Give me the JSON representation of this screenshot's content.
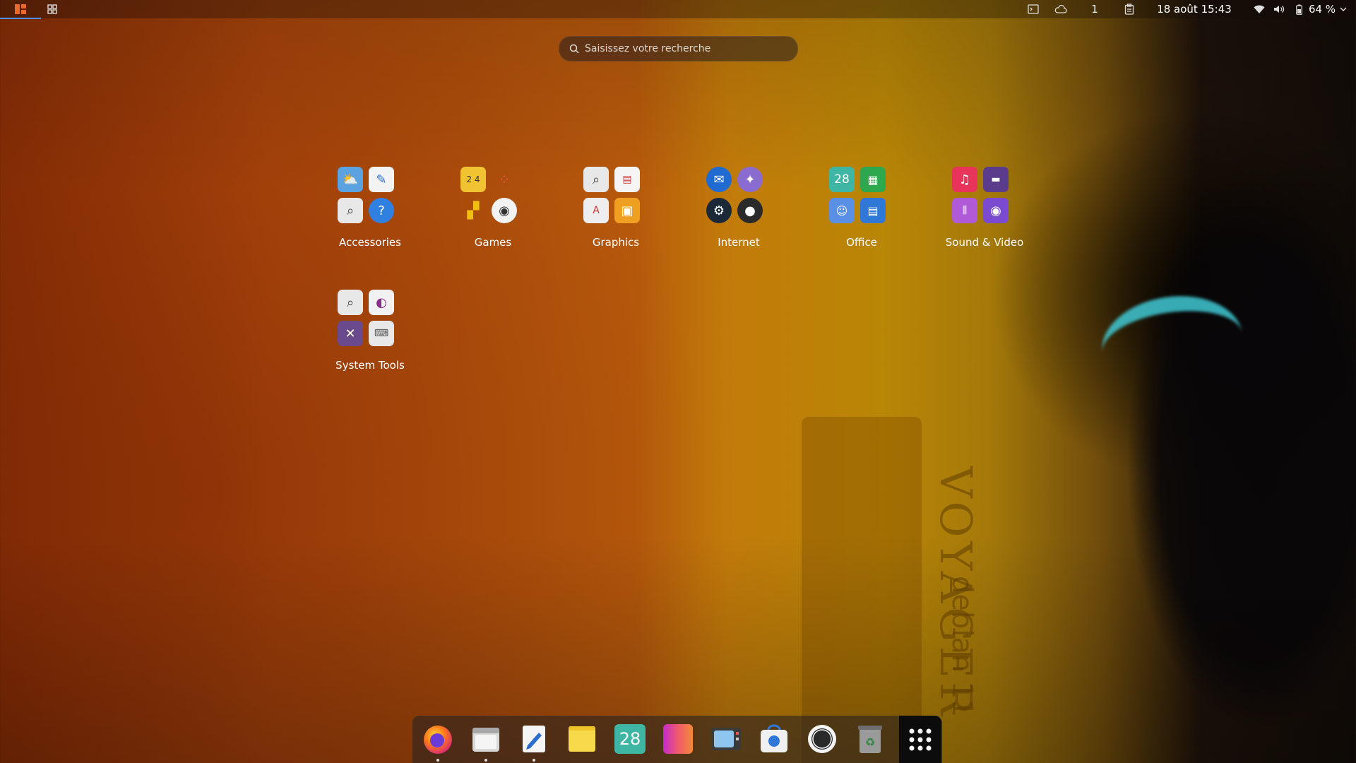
{
  "topbar": {
    "left_icons": [
      "activities-icon",
      "workspaces-grid-icon"
    ],
    "right": {
      "icons": [
        "terminal-icon",
        "weather-icon"
      ],
      "counter": "1",
      "clipboard_icon": "clipboard-icon",
      "datetime": "18 août  15:43",
      "wifi_icon": "wifi-icon",
      "volume_icon": "volume-icon",
      "battery_icon": "battery-icon",
      "battery": "64 %",
      "menu_icon": "chevron-down-icon"
    }
  },
  "search": {
    "placeholder": "Saisissez votre recherche",
    "icon": "search-icon"
  },
  "folders": [
    {
      "label": "Accessories",
      "icons": [
        "weather-app-icon",
        "text-editor-icon",
        "search-app-icon",
        "help-icon"
      ]
    },
    {
      "label": "Games",
      "icons": [
        "2048-icon",
        "dots-game-icon",
        "tetris-icon",
        "robot-game-icon"
      ]
    },
    {
      "label": "Graphics",
      "icons": [
        "image-viewer-icon",
        "document-viewer-icon",
        "font-viewer-icon",
        "photo-app-icon"
      ]
    },
    {
      "label": "Internet",
      "icons": [
        "thunderbird-icon",
        "pidgin-icon",
        "steam-icon",
        "tor-icon"
      ]
    },
    {
      "label": "Office",
      "icons": [
        "calendar-icon",
        "spreadsheet-icon",
        "contacts-icon",
        "writer-icon"
      ]
    },
    {
      "label": "Sound & Video",
      "icons": [
        "music-icon",
        "video-editor-icon",
        "audio-recorder-icon",
        "camera-icon"
      ]
    },
    {
      "label": "System Tools",
      "icons": [
        "disk-usage-icon",
        "tweaks-icon",
        "screen-settings-icon",
        "keyboard-icon"
      ]
    }
  ],
  "calendar_day": "28",
  "dock": [
    {
      "name": "firefox-icon",
      "running": true
    },
    {
      "name": "files-icon",
      "running": true
    },
    {
      "name": "text-editor-icon",
      "running": true
    },
    {
      "name": "notes-icon",
      "running": false
    },
    {
      "name": "calendar-icon",
      "running": false
    },
    {
      "name": "color-app-icon",
      "running": false
    },
    {
      "name": "screenshot-icon",
      "running": false
    },
    {
      "name": "software-store-icon",
      "running": false
    },
    {
      "name": "circle-app-icon",
      "running": false
    },
    {
      "name": "trash-icon",
      "running": false
    },
    {
      "name": "show-apps-icon",
      "running": false
    }
  ],
  "wallpaper": {
    "watermark": "VOYAGER",
    "subtitle": "debian 11"
  }
}
